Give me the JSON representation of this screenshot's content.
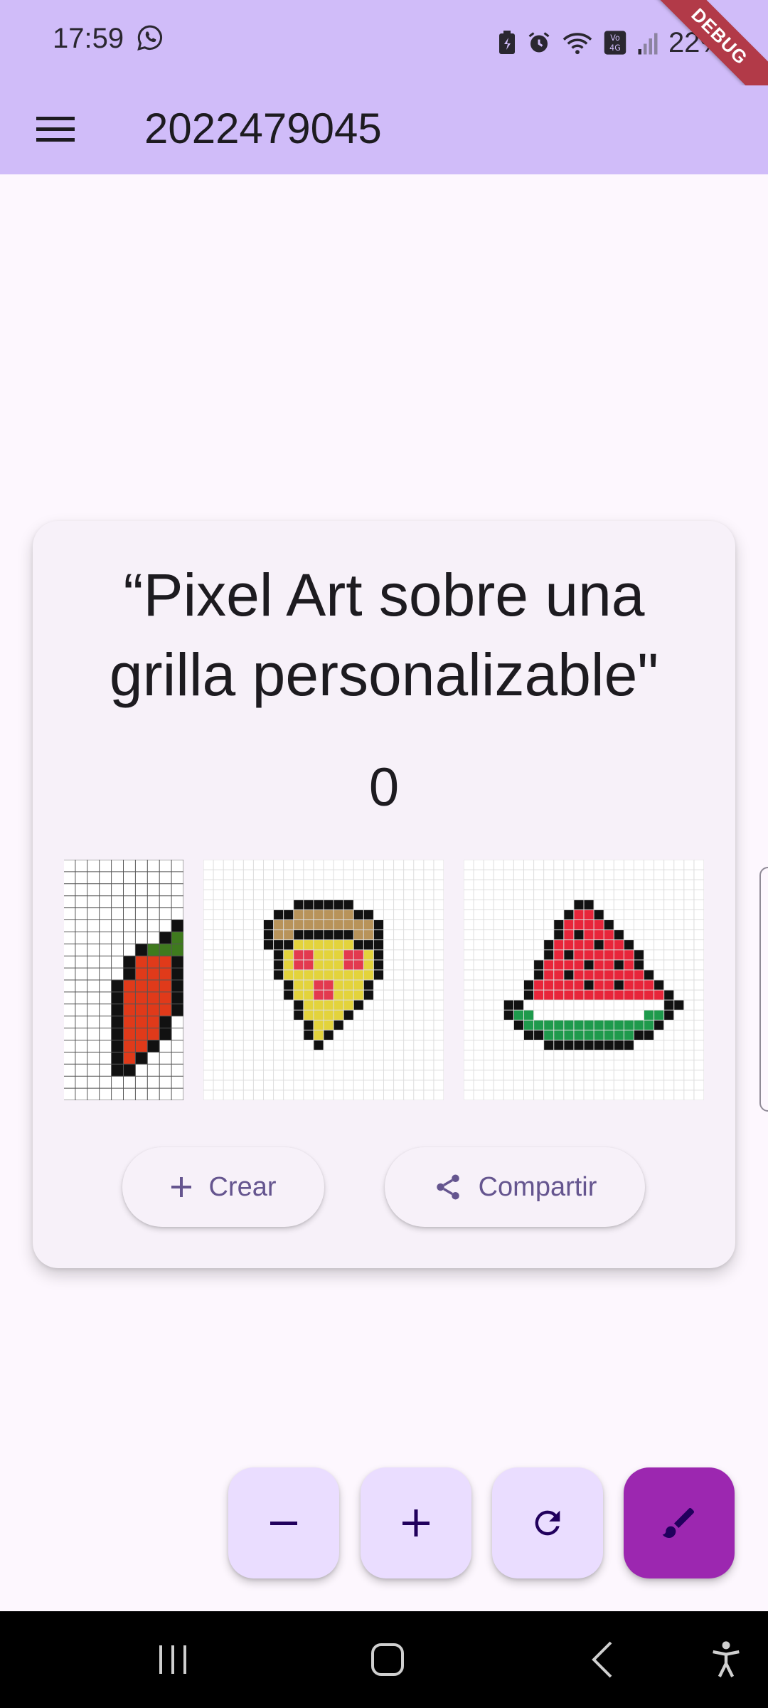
{
  "status_bar": {
    "time": "17:59",
    "battery": "22%",
    "icons": [
      "whatsapp-icon",
      "battery-saver-icon",
      "alarm-icon",
      "wifi-icon",
      "volte-4g-icon",
      "signal-icon"
    ]
  },
  "app_bar": {
    "title": "2022479045",
    "menu_icon": "menu-icon",
    "debug_banner": "DEBUG"
  },
  "card": {
    "title_line1": "“Pixel Art sobre una",
    "title_line2": "grilla personalizable\"",
    "counter": "0",
    "gallery": [
      {
        "name": "chili-pepper"
      },
      {
        "name": "pizza-slice"
      },
      {
        "name": "watermelon-slice"
      }
    ],
    "actions": {
      "create_label": "Crear",
      "share_label": "Compartir"
    }
  },
  "fabs": [
    "remove-icon",
    "add-icon",
    "refresh-icon",
    "brush-icon"
  ],
  "colors": {
    "app_bar": "#D0BCF9",
    "background": "#FDF7FE",
    "card": "#F7F1F9",
    "fab": "#EADDFF",
    "fab_primary": "#9C27B0",
    "accent_text": "#65558F"
  },
  "nav_bar": [
    "recent-apps-icon",
    "home-icon",
    "back-icon",
    "accessibility-icon"
  ]
}
